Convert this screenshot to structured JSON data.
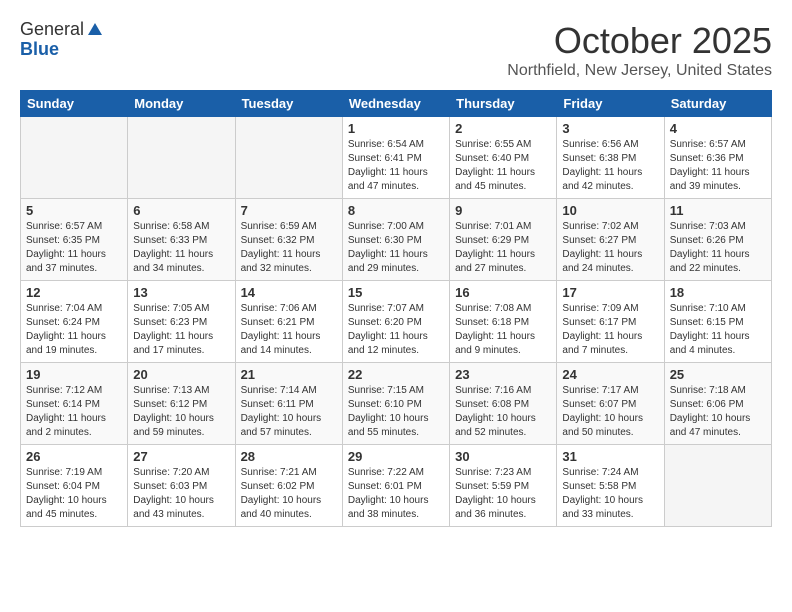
{
  "header": {
    "logo_general": "General",
    "logo_blue": "Blue",
    "month": "October 2025",
    "location": "Northfield, New Jersey, United States"
  },
  "days_of_week": [
    "Sunday",
    "Monday",
    "Tuesday",
    "Wednesday",
    "Thursday",
    "Friday",
    "Saturday"
  ],
  "weeks": [
    [
      {
        "day": "",
        "info": ""
      },
      {
        "day": "",
        "info": ""
      },
      {
        "day": "",
        "info": ""
      },
      {
        "day": "1",
        "info": "Sunrise: 6:54 AM\nSunset: 6:41 PM\nDaylight: 11 hours\nand 47 minutes."
      },
      {
        "day": "2",
        "info": "Sunrise: 6:55 AM\nSunset: 6:40 PM\nDaylight: 11 hours\nand 45 minutes."
      },
      {
        "day": "3",
        "info": "Sunrise: 6:56 AM\nSunset: 6:38 PM\nDaylight: 11 hours\nand 42 minutes."
      },
      {
        "day": "4",
        "info": "Sunrise: 6:57 AM\nSunset: 6:36 PM\nDaylight: 11 hours\nand 39 minutes."
      }
    ],
    [
      {
        "day": "5",
        "info": "Sunrise: 6:57 AM\nSunset: 6:35 PM\nDaylight: 11 hours\nand 37 minutes."
      },
      {
        "day": "6",
        "info": "Sunrise: 6:58 AM\nSunset: 6:33 PM\nDaylight: 11 hours\nand 34 minutes."
      },
      {
        "day": "7",
        "info": "Sunrise: 6:59 AM\nSunset: 6:32 PM\nDaylight: 11 hours\nand 32 minutes."
      },
      {
        "day": "8",
        "info": "Sunrise: 7:00 AM\nSunset: 6:30 PM\nDaylight: 11 hours\nand 29 minutes."
      },
      {
        "day": "9",
        "info": "Sunrise: 7:01 AM\nSunset: 6:29 PM\nDaylight: 11 hours\nand 27 minutes."
      },
      {
        "day": "10",
        "info": "Sunrise: 7:02 AM\nSunset: 6:27 PM\nDaylight: 11 hours\nand 24 minutes."
      },
      {
        "day": "11",
        "info": "Sunrise: 7:03 AM\nSunset: 6:26 PM\nDaylight: 11 hours\nand 22 minutes."
      }
    ],
    [
      {
        "day": "12",
        "info": "Sunrise: 7:04 AM\nSunset: 6:24 PM\nDaylight: 11 hours\nand 19 minutes."
      },
      {
        "day": "13",
        "info": "Sunrise: 7:05 AM\nSunset: 6:23 PM\nDaylight: 11 hours\nand 17 minutes."
      },
      {
        "day": "14",
        "info": "Sunrise: 7:06 AM\nSunset: 6:21 PM\nDaylight: 11 hours\nand 14 minutes."
      },
      {
        "day": "15",
        "info": "Sunrise: 7:07 AM\nSunset: 6:20 PM\nDaylight: 11 hours\nand 12 minutes."
      },
      {
        "day": "16",
        "info": "Sunrise: 7:08 AM\nSunset: 6:18 PM\nDaylight: 11 hours\nand 9 minutes."
      },
      {
        "day": "17",
        "info": "Sunrise: 7:09 AM\nSunset: 6:17 PM\nDaylight: 11 hours\nand 7 minutes."
      },
      {
        "day": "18",
        "info": "Sunrise: 7:10 AM\nSunset: 6:15 PM\nDaylight: 11 hours\nand 4 minutes."
      }
    ],
    [
      {
        "day": "19",
        "info": "Sunrise: 7:12 AM\nSunset: 6:14 PM\nDaylight: 11 hours\nand 2 minutes."
      },
      {
        "day": "20",
        "info": "Sunrise: 7:13 AM\nSunset: 6:12 PM\nDaylight: 10 hours\nand 59 minutes."
      },
      {
        "day": "21",
        "info": "Sunrise: 7:14 AM\nSunset: 6:11 PM\nDaylight: 10 hours\nand 57 minutes."
      },
      {
        "day": "22",
        "info": "Sunrise: 7:15 AM\nSunset: 6:10 PM\nDaylight: 10 hours\nand 55 minutes."
      },
      {
        "day": "23",
        "info": "Sunrise: 7:16 AM\nSunset: 6:08 PM\nDaylight: 10 hours\nand 52 minutes."
      },
      {
        "day": "24",
        "info": "Sunrise: 7:17 AM\nSunset: 6:07 PM\nDaylight: 10 hours\nand 50 minutes."
      },
      {
        "day": "25",
        "info": "Sunrise: 7:18 AM\nSunset: 6:06 PM\nDaylight: 10 hours\nand 47 minutes."
      }
    ],
    [
      {
        "day": "26",
        "info": "Sunrise: 7:19 AM\nSunset: 6:04 PM\nDaylight: 10 hours\nand 45 minutes."
      },
      {
        "day": "27",
        "info": "Sunrise: 7:20 AM\nSunset: 6:03 PM\nDaylight: 10 hours\nand 43 minutes."
      },
      {
        "day": "28",
        "info": "Sunrise: 7:21 AM\nSunset: 6:02 PM\nDaylight: 10 hours\nand 40 minutes."
      },
      {
        "day": "29",
        "info": "Sunrise: 7:22 AM\nSunset: 6:01 PM\nDaylight: 10 hours\nand 38 minutes."
      },
      {
        "day": "30",
        "info": "Sunrise: 7:23 AM\nSunset: 5:59 PM\nDaylight: 10 hours\nand 36 minutes."
      },
      {
        "day": "31",
        "info": "Sunrise: 7:24 AM\nSunset: 5:58 PM\nDaylight: 10 hours\nand 33 minutes."
      },
      {
        "day": "",
        "info": ""
      }
    ]
  ]
}
